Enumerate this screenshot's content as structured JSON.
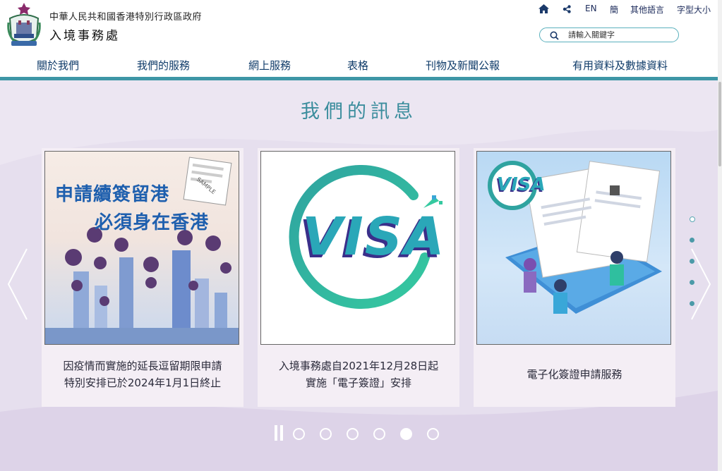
{
  "org": {
    "government": "中華人民共和國香港特別行政區政府",
    "department": "入境事務處"
  },
  "utility": {
    "en": "EN",
    "simplified": "簡",
    "other_languages": "其他語言",
    "font_size": "字型大小"
  },
  "search": {
    "placeholder": "請輸入關鍵字"
  },
  "nav": [
    {
      "label": "關於我們"
    },
    {
      "label": "我們的服務"
    },
    {
      "label": "網上服務"
    },
    {
      "label": "表格"
    },
    {
      "label": "刊物及新聞公報"
    },
    {
      "label": "有用資料及數據資料"
    }
  ],
  "section": {
    "title": "我們的訊息"
  },
  "cards": [
    {
      "image_title_line1": "申請續簽留港",
      "image_title_line2": "必須身在香港",
      "stamp_text": "SAMPLE",
      "caption_line1": "因疫情而實施的延長逗留期限申請",
      "caption_line2": "特別安排已於2024年1月1日終止"
    },
    {
      "logo_text": "VISA",
      "caption_line1": "入境事務處自2021年12月28日起",
      "caption_line2": "實施「電子簽證」安排"
    },
    {
      "logo_text": "VISA",
      "caption_line1": "電子化簽證申請服務"
    }
  ],
  "carousel": {
    "page_count": 5,
    "active_page": 4,
    "paused": true
  },
  "colors": {
    "teal": "#3e96a6",
    "heading": "#3b8d9d",
    "nav_text": "#103c6a",
    "stage_bg": "#e6dfee",
    "card_bg": "#f4eef5"
  }
}
